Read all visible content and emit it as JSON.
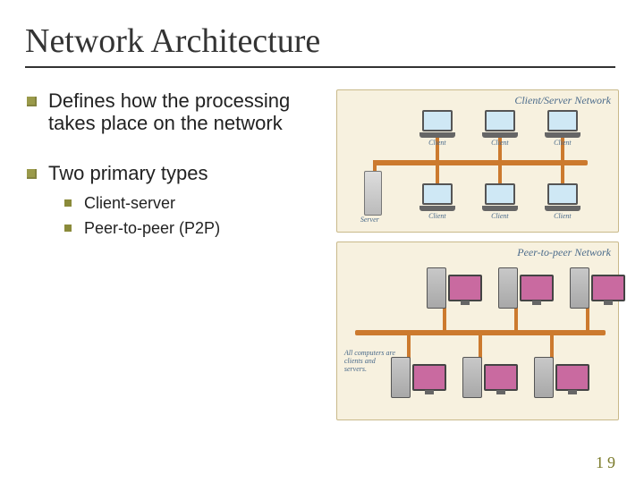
{
  "title": "Network Architecture",
  "bullets": {
    "b1": "Defines how the processing takes place on the network",
    "b2": "Two primary types",
    "sub1": "Client-server",
    "sub2": "Peer-to-peer (P2P)"
  },
  "diagrams": {
    "top_label": "Client/Server Network",
    "bot_label": "Peer-to-peer Network",
    "client_label": "Client",
    "server_label": "Server",
    "p2p_note": "All computers are clients and servers."
  },
  "page_number": "19"
}
